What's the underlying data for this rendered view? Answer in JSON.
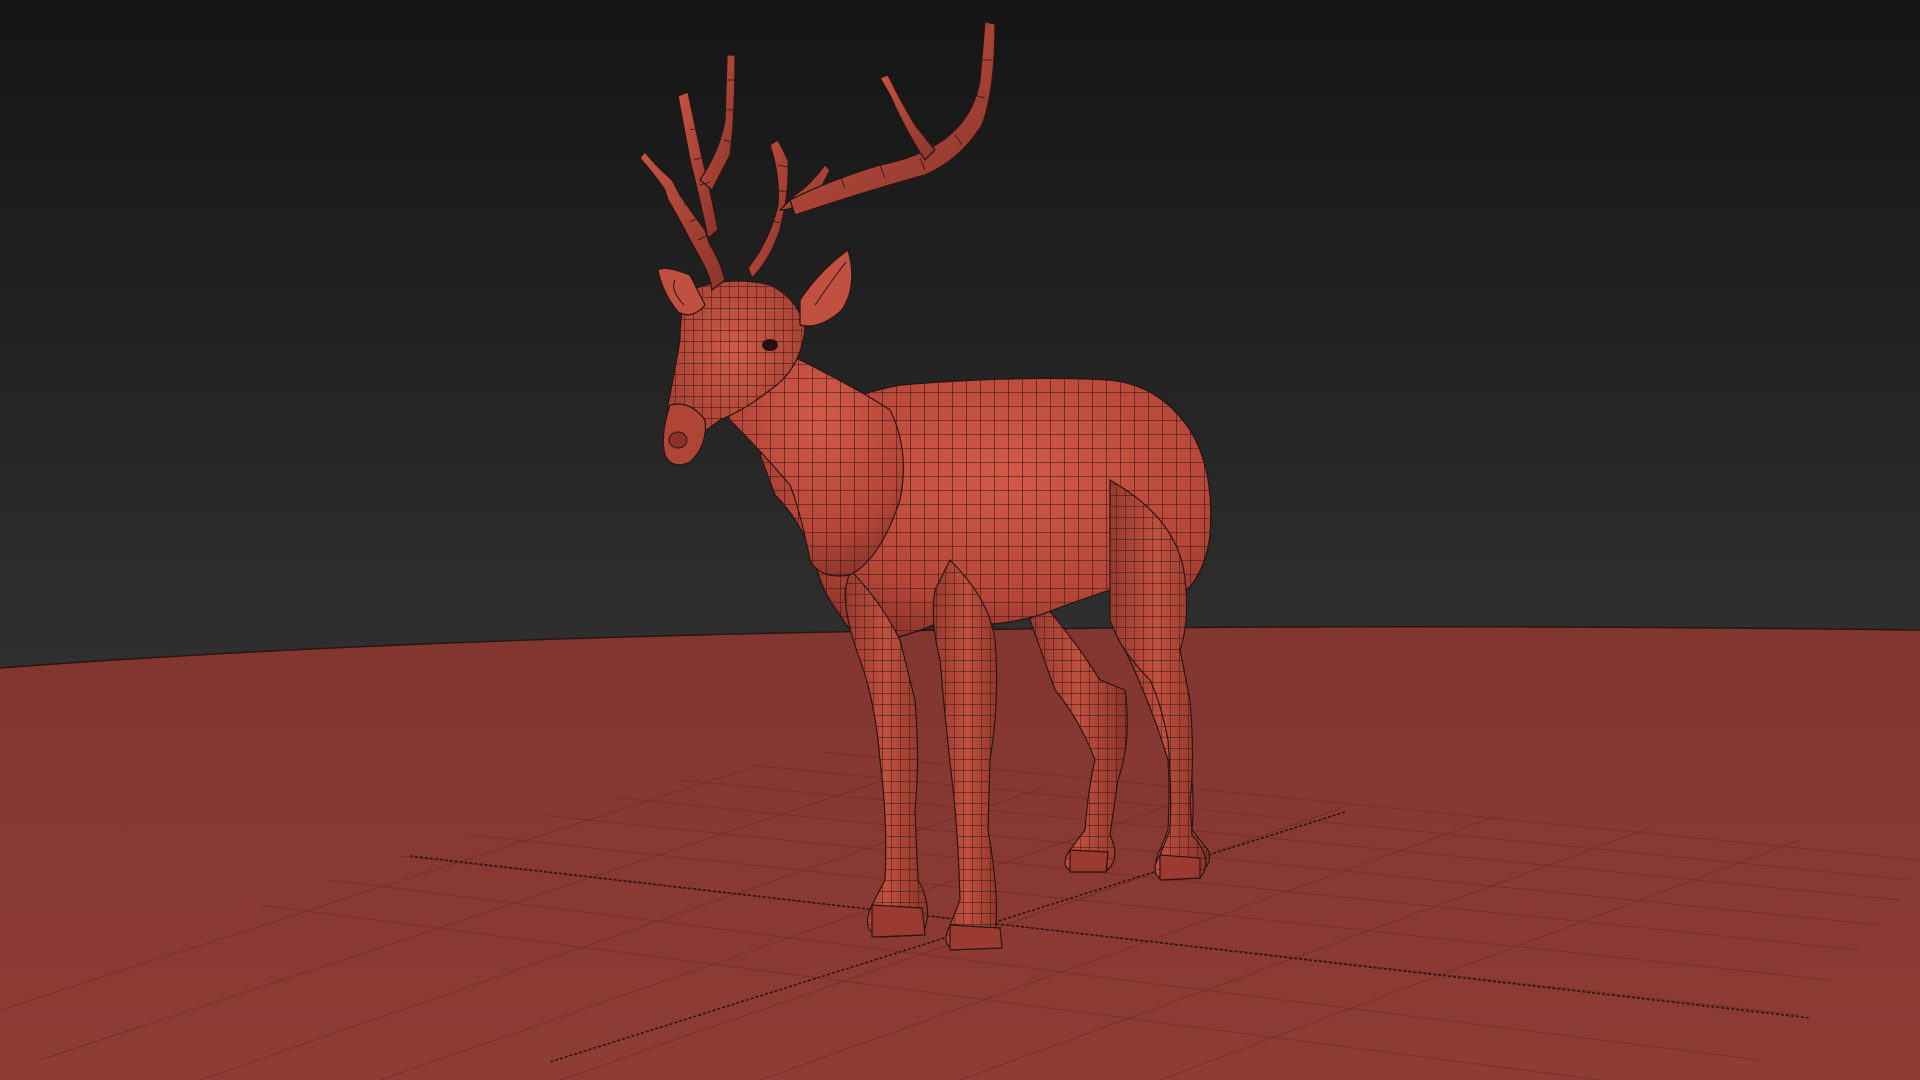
{
  "viewport": {
    "background_top": "#151515",
    "background_bottom": "#3d3d3d",
    "ground_color": "#8c3b33",
    "ground_far_color": "#823630",
    "model_color": "#b9493b",
    "model_shadow": "#7f2e26",
    "model_highlight": "#d8604c",
    "wire_color": "#2a1512",
    "grid_color": "#6e2d27",
    "axis_color": "#2b1512"
  },
  "scene": {
    "model_icon": "deer-mesh-icon",
    "grid_icon": "ground-grid-icon"
  }
}
